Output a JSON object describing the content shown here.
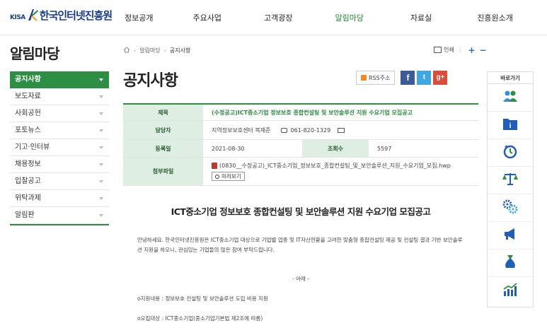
{
  "header": {
    "logo_prefix": "KISA",
    "logo_name": "한국인터넷진흥원",
    "nav": [
      "정보공개",
      "주요사업",
      "고객광장",
      "알림마당",
      "자료실",
      "진흥원소개"
    ],
    "active_nav": "알림마당"
  },
  "sidebar": {
    "title": "알림마당",
    "items": [
      "공지사항",
      "보도자료",
      "사회공헌",
      "포토뉴스",
      "기고·인터뷰",
      "채용정보",
      "입찰공고",
      "위탁과제",
      "알림판"
    ],
    "active": "공지사항"
  },
  "breadcrumb": {
    "home_icon": "home-icon",
    "items": [
      "알림마당",
      "공지사항"
    ]
  },
  "utility": {
    "print_label": "인쇄",
    "zoom_in": "+",
    "zoom_out": "−"
  },
  "page_title": "공지사항",
  "social": {
    "rss_label": "RSS주소",
    "facebook": "f",
    "twitter": "t",
    "google": "g+"
  },
  "post": {
    "title_label": "제목",
    "title": "(수정공고)ICT중소기업 정보보호 종합컨설팅 및 보안솔루션 지원 수요기업 모집공고",
    "contact_label": "담당자",
    "contact_name": "지역정보보호센터 복재준",
    "contact_phone": "061-820-1329",
    "date_label": "등록일",
    "date": "2021-08-30",
    "views_label": "조회수",
    "views": "5597",
    "file_label": "첨부파일",
    "file_name": "(0830__수정공고)_ICT중소기업_정보보호_종합컨설팅_및_보안솔루션_지원_수요기업_모집.hwp",
    "preview_label": "미리보기"
  },
  "content": {
    "heading": "ICT중소기업 정보보호 종합컨설팅 및 보안솔루션 지원 수요기업 모집공고",
    "intro_1": "안녕하세요. 한국인터넷진흥원은 ICT중소기업 대상으로 기업별 업종 및 IT자산현황을 고려한 맞춤형 종합컨설팅 제공 및 컨설팅 결과 기반 보안솔루",
    "intro_2": "션 지원을 하오니, 관심있는 기업들의 많은 참여 부탁드립니다.",
    "divider": "- 아래 -",
    "item_1": "o지원내용 : 정보보호 컨설팅 및 보안솔루션 도입 비용 지원",
    "item_2": "o모집대상 : ICT중소기업(중소기업기본법 제2조에 따름)"
  },
  "quick": {
    "title": "바로가기",
    "icons": [
      "people-icon",
      "folder-info-icon",
      "clock-refresh-icon",
      "scale-icon",
      "gears-icon",
      "megaphone-icon",
      "money-bag-icon",
      "bar-chart-icon"
    ]
  },
  "colors": {
    "brand_green": "#2c8f43",
    "brand_blue": "#1a3c8c",
    "accent_blue": "#2b6cc4"
  }
}
